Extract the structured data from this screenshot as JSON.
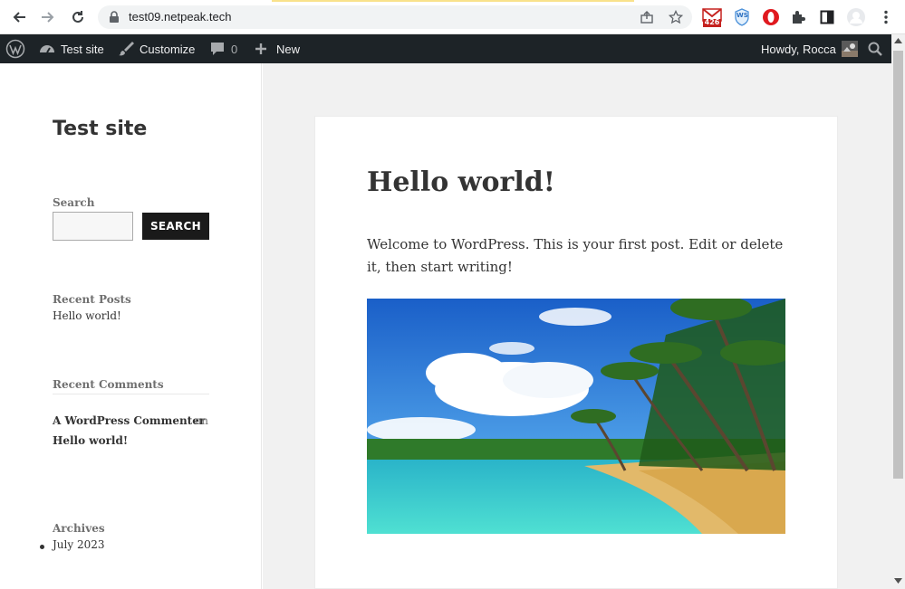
{
  "browser": {
    "url": "test09.netpeak.tech",
    "gmail_badge": "426",
    "extension_label": "WS"
  },
  "adminbar": {
    "site_name": "Test site",
    "customize": "Customize",
    "comments_count": "0",
    "new_label": "New",
    "howdy": "Howdy, Rocca"
  },
  "sidebar": {
    "site_title": "Test site",
    "search_label": "Search",
    "search_button": "SEARCH",
    "recent_posts_title": "Recent Posts",
    "recent_post_1": "Hello world!",
    "recent_comments_title": "Recent Comments",
    "comment_author": "A WordPress Commenter",
    "comment_on": "on",
    "comment_post": "Hello world!",
    "archives_title": "Archives",
    "archive_1": "July 2023"
  },
  "post": {
    "title": "Hello world!",
    "body": "Welcome to WordPress. This is your first post. Edit or delete it, then start writing!"
  },
  "colors": {
    "adminbar_bg": "#1d2327",
    "accent_dark": "#1a1a1a"
  }
}
